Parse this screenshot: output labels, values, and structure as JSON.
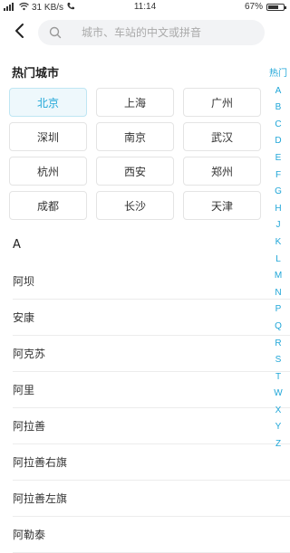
{
  "status_bar": {
    "network_speed": "31 KB/s",
    "time": "11:14",
    "battery_percent": "67%",
    "battery_level": 0.67
  },
  "header": {
    "search_placeholder": "城市、车站的中文或拼音"
  },
  "hot_cities": {
    "title": "热门城市",
    "items": [
      {
        "label": "北京",
        "selected": true
      },
      {
        "label": "上海",
        "selected": false
      },
      {
        "label": "广州",
        "selected": false
      },
      {
        "label": "深圳",
        "selected": false
      },
      {
        "label": "南京",
        "selected": false
      },
      {
        "label": "武汉",
        "selected": false
      },
      {
        "label": "杭州",
        "selected": false
      },
      {
        "label": "西安",
        "selected": false
      },
      {
        "label": "郑州",
        "selected": false
      },
      {
        "label": "成都",
        "selected": false
      },
      {
        "label": "长沙",
        "selected": false
      },
      {
        "label": "天津",
        "selected": false
      }
    ]
  },
  "city_list": {
    "section_letter": "A",
    "items": [
      "阿坝",
      "安康",
      "阿克苏",
      "阿里",
      "阿拉善",
      "阿拉善右旗",
      "阿拉善左旗",
      "阿勒泰"
    ]
  },
  "index_bar": {
    "items": [
      "热门",
      "A",
      "B",
      "C",
      "D",
      "E",
      "F",
      "G",
      "H",
      "J",
      "K",
      "L",
      "M",
      "N",
      "P",
      "Q",
      "R",
      "S",
      "T",
      "W",
      "X",
      "Y",
      "Z"
    ]
  },
  "colors": {
    "accent": "#1fa6d8",
    "selected_bg": "#eef8fc"
  },
  "icons": {
    "back": "chevron-left-icon",
    "search": "search-icon",
    "signal": "signal-icon",
    "wifi": "wifi-icon",
    "call": "call-icon"
  }
}
